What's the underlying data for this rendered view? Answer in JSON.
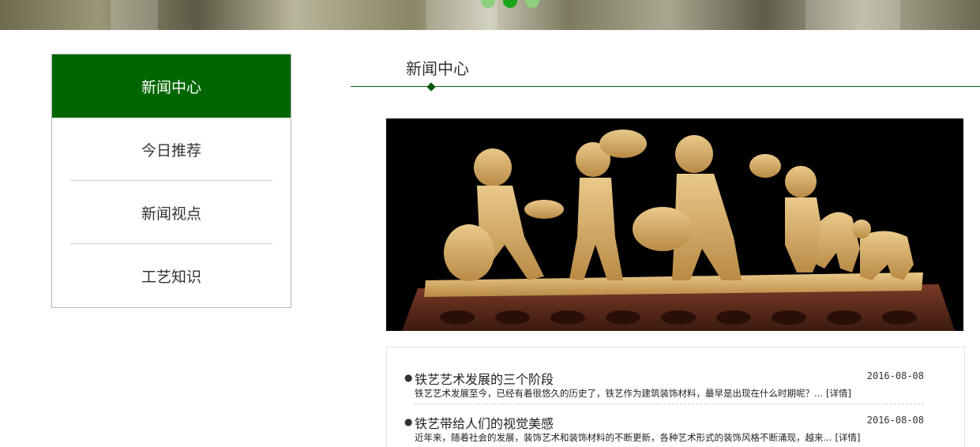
{
  "banner": {
    "slides": 3,
    "active_slide": 2,
    "colors": {
      "dot": "#8fd07f",
      "dot_active": "#1aa51a"
    }
  },
  "sidebar": {
    "accent": "#006600",
    "items": [
      {
        "label": "新闻中心",
        "active": true
      },
      {
        "label": "今日推荐",
        "active": false
      },
      {
        "label": "新闻视点",
        "active": false
      },
      {
        "label": "工艺知识",
        "active": false
      }
    ]
  },
  "section": {
    "title": "新闻中心"
  },
  "feature_image": {
    "subject": "wood-carving-children-musicians-photo"
  },
  "news": [
    {
      "title": "铁艺艺术发展的三个阶段",
      "date": "2016-08-08",
      "summary": "铁艺艺术发展至今，已经有着很悠久的历史了，铁艺作为建筑装饰材料，最早是出现在什么时期呢？...",
      "detail_label": "[详情]"
    },
    {
      "title": "铁艺带给人们的视觉美感",
      "date": "2016-08-08",
      "summary": "近年来，随着社会的发展，装饰艺术和装饰材料的不断更新，各种艺术形式的装饰风格不断涌现，越来...",
      "detail_label": "[详情]"
    }
  ]
}
